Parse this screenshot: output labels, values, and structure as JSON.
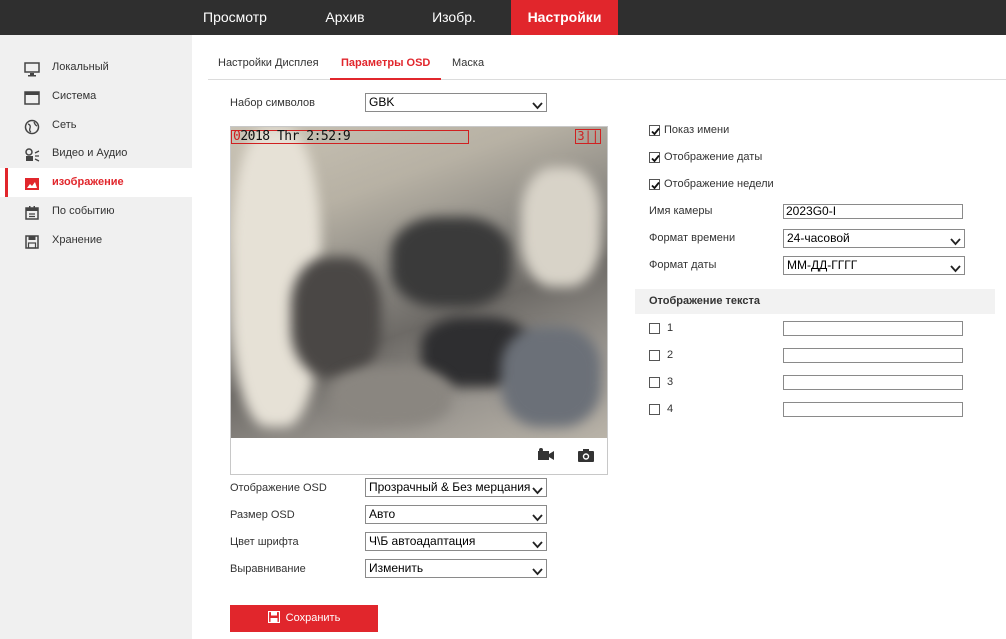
{
  "topnav": [
    {
      "label": "Просмотр"
    },
    {
      "label": "Архив"
    },
    {
      "label": "Изобр."
    },
    {
      "label": "Настройки"
    }
  ],
  "sidebar": [
    {
      "label": "Локальный",
      "icon": "monitor-icon"
    },
    {
      "label": "Система",
      "icon": "window-icon"
    },
    {
      "label": "Сеть",
      "icon": "globe-icon"
    },
    {
      "label": "Видео и Аудио",
      "icon": "video-audio-icon"
    },
    {
      "label": "изображение",
      "icon": "image-icon"
    },
    {
      "label": "По событию",
      "icon": "calendar-icon"
    },
    {
      "label": "Хранение",
      "icon": "storage-icon"
    }
  ],
  "tabs": [
    {
      "label": "Настройки Дисплея"
    },
    {
      "label": "Параметры OSD"
    },
    {
      "label": "Маска"
    }
  ],
  "charset": {
    "label": "Набор символов",
    "value": "GBK"
  },
  "preview": {
    "osd_prefix": "0",
    "osd_datetime": "2018  Thr  2:52:9",
    "osd_right": "3||"
  },
  "osd_settings": {
    "display": {
      "label": "Отображение OSD",
      "value": "Прозрачный & Без мерцания"
    },
    "size": {
      "label": "Размер OSD",
      "value": "Авто"
    },
    "color": {
      "label": "Цвет шрифта",
      "value": "Ч\\Б автоадаптация"
    },
    "align": {
      "label": "Выравнивание",
      "value": "Изменить"
    }
  },
  "display_options": {
    "show_name": {
      "label": "Показ имени",
      "checked": true
    },
    "show_date": {
      "label": "Отображение даты",
      "checked": true
    },
    "show_week": {
      "label": "Отображение недели",
      "checked": true
    }
  },
  "camera": {
    "name_label": "Имя камеры",
    "name_value": "2023G0-I",
    "time_format_label": "Формат времени",
    "time_format_value": "24-часовой",
    "date_format_label": "Формат даты",
    "date_format_value": "ММ-ДД-ГГГГ"
  },
  "text_overlay": {
    "title": "Отображение текста",
    "items": [
      {
        "label": "1",
        "checked": false,
        "value": ""
      },
      {
        "label": "2",
        "checked": false,
        "value": ""
      },
      {
        "label": "3",
        "checked": false,
        "value": ""
      },
      {
        "label": "4",
        "checked": false,
        "value": ""
      }
    ]
  },
  "save": {
    "label": "Сохранить"
  },
  "colors": {
    "accent": "#e1262c",
    "topbar": "#2f2f2f",
    "sidebar": "#f0f0f0"
  }
}
